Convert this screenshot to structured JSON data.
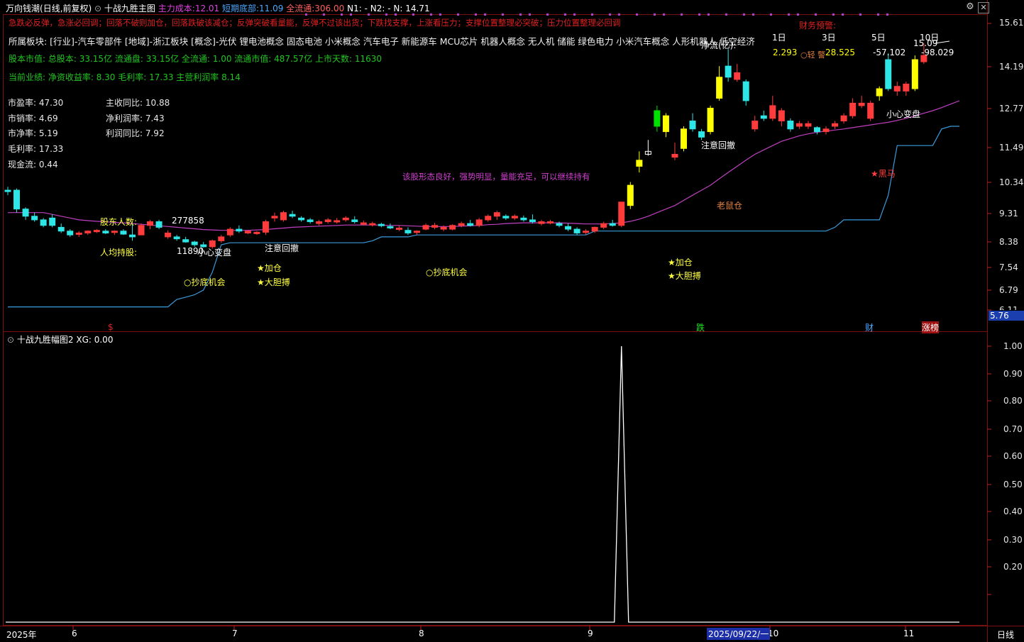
{
  "header": {
    "stock_name": "万向钱潮",
    "period": "(日线,前复权)",
    "indicator": "十战九胜主图",
    "cost_label": "主力成本:",
    "cost_value": "12.01",
    "short_bottom_label": "短期底部:",
    "short_bottom_value": "11.09",
    "float_label": "全流通:",
    "float_value": "306.00",
    "n1_label": "N1: -",
    "n2_label": "N2: -",
    "n_label": "N: 14.71"
  },
  "warning_line": "急跌必反弹，急涨必回调；回落不破则加仓，回落跌破该减仓；反弹突破看量能，反弹不过该出货；下跌找支撑，上涨看压力；支撑位置整理必突破；压力位置整理必回调",
  "sectors_line": "所属板块: [行业]-汽车零部件 [地域]-浙江板块 [概念]-光伏 锂电池概念 固态电池 小米概念 汽车电子 新能源车 MCU芯片 机器人概念 无人机 储能 绿色电力 小米汽车概念 人形机器人 低空经济",
  "market_value_line": "股本市值: 总股本: 33.15亿 流通盘: 33.15亿 全流通: 1.00 流通市值: 487.57亿 上市天数: 11630",
  "performance_line": "当前业绩:  净资收益率: 8.30 毛利率: 17.33 主营利润率 8.14",
  "finance_left": [
    {
      "label": "市盈率: 47.30"
    },
    {
      "label": "市销率: 4.69"
    },
    {
      "label": "市净率: 5.19"
    },
    {
      "label": "毛利率: 17.33"
    },
    {
      "label": "现金流: 0.44"
    }
  ],
  "finance_right": [
    {
      "label": "主收同比: 10.88"
    },
    {
      "label": "净利润率: 7.43"
    },
    {
      "label": "利润同比: 7.92"
    }
  ],
  "fund_flow": {
    "title": "财务预警:",
    "flow_label": "净流(亿):",
    "periods": [
      "1日",
      "3日",
      "5日",
      "10日"
    ],
    "values": [
      "2.293",
      "28.525",
      "-57.102",
      "-98.029"
    ],
    "alert": "○轻 警"
  },
  "shareholders": {
    "label": "股东人数:",
    "value": "277858",
    "avg_label": "人均持股:",
    "avg_value": "11890"
  },
  "comment": "该股形态良好，强势明显，量能充足，可以继续持有",
  "annotations": {
    "careful": "小心变盘",
    "careful_right": "小心变盘",
    "pullback_1": "注意回撤",
    "pullback_2": "注意回撤",
    "add_1": "★加仓",
    "add_2": "★加仓",
    "bold_1": "★大胆搏",
    "bold_2": "★大胆搏",
    "bottom_1": "○抄底机会",
    "bottom_2": "○抄底机会",
    "rat": "老鼠仓",
    "dark_horse": "★黑马",
    "high_price": "15.09"
  },
  "bottom_markers": {
    "dollar": "$",
    "fall": "跌",
    "finance": "财",
    "limit_list": "涨榜"
  },
  "price_axis": [
    "15.61",
    "14.19",
    "12.77",
    "11.49",
    "10.34",
    "9.31",
    "8.38",
    "7.54",
    "6.79",
    "6.11"
  ],
  "price_axis_current": "5.76",
  "sub_panel": {
    "title": "十战九胜幅图2",
    "xg_label": "XG: 0.00",
    "axis": [
      "1.00",
      "0.90",
      "0.80",
      "0.70",
      "0.60",
      "0.50",
      "0.40",
      "0.30",
      "0.20"
    ]
  },
  "time_axis": {
    "labels": [
      "2025年",
      "6",
      "7",
      "8",
      "9",
      "10",
      "11"
    ],
    "cursor_date": "2025/09/22/一",
    "period_label": "日线"
  },
  "colors": {
    "up": "#ff3b3b",
    "down": "#2ee6e6",
    "ma": "#c040c0",
    "support": "#3a9bdc",
    "yellow": "#ffff00",
    "green": "#00e000",
    "accent_red": "#e02020"
  },
  "chart_data": {
    "type": "candlestick",
    "y_scale": "log",
    "ylim": [
      5.76,
      15.61
    ],
    "count": 108,
    "candles": [
      [
        8.85,
        8.95,
        8.7,
        8.85,
        "d"
      ],
      [
        8.85,
        8.9,
        8.2,
        8.3,
        "d"
      ],
      [
        8.3,
        8.35,
        8.0,
        8.1,
        "d"
      ],
      [
        8.1,
        8.2,
        7.95,
        8.0,
        "d"
      ],
      [
        8.0,
        8.05,
        7.8,
        7.85,
        "d"
      ],
      [
        7.85,
        8.15,
        7.8,
        8.05,
        "d"
      ],
      [
        7.8,
        7.9,
        7.65,
        7.7,
        "d"
      ],
      [
        7.7,
        7.75,
        7.55,
        7.6,
        "d"
      ],
      [
        7.62,
        7.7,
        7.55,
        7.65,
        "u"
      ],
      [
        7.65,
        7.72,
        7.6,
        7.7,
        "u"
      ],
      [
        7.7,
        7.75,
        7.65,
        7.72,
        "u"
      ],
      [
        7.7,
        7.75,
        7.62,
        7.65,
        "d"
      ],
      [
        7.68,
        7.72,
        7.6,
        7.7,
        "u"
      ],
      [
        7.7,
        7.75,
        7.6,
        7.62,
        "d"
      ],
      [
        7.6,
        7.9,
        7.45,
        7.55,
        "d"
      ],
      [
        7.6,
        7.9,
        7.6,
        7.85,
        "u"
      ],
      [
        7.85,
        8.0,
        7.75,
        7.95,
        "u"
      ],
      [
        7.95,
        8.0,
        7.75,
        7.8,
        "d"
      ],
      [
        7.65,
        7.72,
        7.5,
        7.55,
        "u"
      ],
      [
        7.55,
        7.6,
        7.45,
        7.5,
        "d"
      ],
      [
        7.48,
        7.55,
        7.4,
        7.42,
        "d"
      ],
      [
        7.42,
        7.45,
        7.3,
        7.35,
        "d"
      ],
      [
        7.35,
        7.42,
        7.28,
        7.3,
        "d"
      ],
      [
        7.3,
        7.48,
        7.25,
        7.45,
        "u"
      ],
      [
        7.45,
        7.6,
        7.4,
        7.55,
        "u"
      ],
      [
        7.6,
        7.8,
        7.55,
        7.75,
        "u"
      ],
      [
        7.75,
        7.85,
        7.65,
        7.7,
        "d"
      ],
      [
        7.7,
        7.72,
        7.62,
        7.65,
        "u"
      ],
      [
        7.65,
        7.7,
        7.6,
        7.67,
        "u"
      ],
      [
        7.67,
        8.0,
        7.6,
        7.95,
        "u"
      ],
      [
        8.05,
        8.2,
        7.95,
        8.1,
        "u"
      ],
      [
        8.0,
        8.25,
        7.95,
        8.2,
        "u"
      ],
      [
        8.15,
        8.25,
        8.05,
        8.1,
        "d"
      ],
      [
        8.05,
        8.1,
        7.95,
        8.0,
        "d"
      ],
      [
        8.0,
        8.05,
        7.9,
        7.95,
        "d"
      ],
      [
        7.9,
        8.0,
        7.85,
        7.95,
        "u"
      ],
      [
        7.95,
        8.05,
        7.9,
        8.0,
        "u"
      ],
      [
        7.95,
        8.05,
        7.9,
        7.98,
        "u"
      ],
      [
        8.0,
        8.1,
        7.95,
        8.05,
        "u"
      ],
      [
        8.0,
        8.1,
        7.9,
        7.95,
        "d"
      ],
      [
        7.92,
        7.98,
        7.85,
        7.88,
        "u"
      ],
      [
        7.88,
        7.95,
        7.82,
        7.9,
        "u"
      ],
      [
        7.88,
        7.92,
        7.8,
        7.85,
        "d"
      ],
      [
        7.82,
        7.9,
        7.75,
        7.8,
        "d"
      ],
      [
        7.78,
        7.85,
        7.7,
        7.75,
        "u"
      ],
      [
        7.72,
        7.8,
        7.6,
        7.65,
        "d"
      ],
      [
        7.68,
        7.72,
        7.6,
        7.7,
        "u"
      ],
      [
        7.75,
        7.9,
        7.72,
        7.85,
        "u"
      ],
      [
        7.85,
        7.92,
        7.75,
        7.8,
        "u"
      ],
      [
        7.8,
        7.85,
        7.7,
        7.75,
        "u"
      ],
      [
        7.75,
        7.88,
        7.72,
        7.85,
        "u"
      ],
      [
        7.85,
        7.95,
        7.8,
        7.9,
        "u"
      ],
      [
        7.9,
        8.0,
        7.82,
        7.85,
        "d"
      ],
      [
        7.85,
        8.05,
        7.8,
        8.0,
        "u"
      ],
      [
        8.0,
        8.15,
        7.95,
        8.1,
        "u"
      ],
      [
        8.1,
        8.25,
        8.0,
        8.2,
        "u"
      ],
      [
        8.1,
        8.15,
        8.0,
        8.05,
        "d"
      ],
      [
        8.05,
        8.15,
        8.0,
        8.1,
        "u"
      ],
      [
        8.05,
        8.12,
        7.95,
        8.0,
        "d"
      ],
      [
        8.0,
        8.15,
        7.9,
        7.95,
        "d"
      ],
      [
        7.95,
        8.0,
        7.85,
        7.9,
        "u"
      ],
      [
        7.92,
        8.0,
        7.88,
        7.95,
        "u"
      ],
      [
        7.9,
        7.95,
        7.8,
        7.85,
        "d"
      ],
      [
        7.82,
        7.9,
        7.7,
        7.75,
        "d"
      ],
      [
        7.75,
        7.8,
        7.6,
        7.65,
        "d"
      ],
      [
        7.68,
        7.75,
        7.6,
        7.7,
        "u"
      ],
      [
        7.7,
        7.82,
        7.65,
        7.8,
        "u"
      ],
      [
        7.8,
        7.95,
        7.75,
        7.9,
        "u"
      ],
      [
        7.9,
        8.0,
        7.82,
        7.85,
        "d"
      ],
      [
        7.85,
        8.3,
        7.8,
        8.5,
        "u"
      ],
      [
        8.4,
        9.1,
        8.3,
        9.0,
        "y"
      ],
      [
        9.6,
        10.1,
        9.4,
        9.8,
        "y"
      ],
      [
        10.0,
        10.5,
        9.95,
        10.1,
        "w"
      ],
      [
        11.0,
        11.8,
        10.8,
        11.6,
        "g"
      ],
      [
        11.4,
        11.5,
        10.6,
        10.8,
        "y"
      ],
      [
        10.0,
        10.4,
        9.8,
        9.9,
        "u"
      ],
      [
        10.2,
        11.0,
        10.1,
        10.9,
        "y"
      ],
      [
        10.9,
        11.5,
        10.8,
        11.2,
        "d"
      ],
      [
        10.6,
        10.9,
        10.5,
        10.8,
        "d"
      ],
      [
        10.8,
        11.8,
        10.7,
        11.7,
        "y"
      ],
      [
        12.1,
        13.5,
        12.0,
        13.0,
        "y"
      ],
      [
        13.0,
        14.3,
        12.8,
        13.5,
        "d"
      ],
      [
        13.2,
        13.6,
        12.8,
        12.9,
        "u"
      ],
      [
        12.8,
        12.9,
        11.8,
        12.0,
        "d"
      ],
      [
        11.2,
        11.4,
        10.8,
        10.9,
        "u"
      ],
      [
        11.4,
        11.6,
        11.2,
        11.3,
        "d"
      ],
      [
        11.3,
        12.2,
        11.2,
        11.8,
        "u"
      ],
      [
        11.6,
        11.7,
        11.0,
        11.2,
        "u"
      ],
      [
        11.2,
        11.3,
        10.8,
        10.9,
        "d"
      ],
      [
        11.0,
        11.2,
        10.9,
        11.1,
        "u"
      ],
      [
        11.1,
        11.2,
        10.9,
        11.0,
        "u"
      ],
      [
        10.95,
        11.0,
        10.7,
        10.8,
        "d"
      ],
      [
        10.8,
        11.0,
        10.7,
        10.9,
        "u"
      ],
      [
        11.0,
        11.2,
        10.9,
        11.1,
        "u"
      ],
      [
        11.2,
        11.5,
        11.1,
        11.4,
        "u"
      ],
      [
        11.4,
        12.1,
        11.3,
        11.9,
        "u"
      ],
      [
        11.9,
        12.2,
        11.7,
        11.8,
        "u"
      ],
      [
        11.3,
        12.0,
        11.2,
        11.9,
        "u"
      ],
      [
        12.2,
        12.6,
        12.0,
        12.5,
        "y"
      ],
      [
        12.5,
        14.1,
        12.4,
        13.8,
        "d"
      ],
      [
        12.6,
        12.8,
        12.2,
        12.4,
        "u"
      ],
      [
        12.4,
        12.8,
        12.2,
        12.7,
        "u"
      ],
      [
        12.5,
        14.0,
        12.4,
        13.8,
        "y"
      ],
      [
        13.7,
        14.6,
        13.6,
        14.0,
        "u"
      ]
    ],
    "ma_line": [
      8.2,
      8.2,
      8.2,
      8.2,
      8.2,
      8.15,
      8.1,
      8.05,
      8.0,
      7.98,
      7.96,
      7.95,
      7.93,
      7.92,
      7.9,
      7.88,
      7.86,
      7.84,
      7.82,
      7.8,
      7.78,
      7.76,
      7.74,
      7.73,
      7.72,
      7.72,
      7.72,
      7.72,
      7.73,
      7.74,
      7.76,
      7.78,
      7.8,
      7.81,
      7.82,
      7.83,
      7.84,
      7.85,
      7.86,
      7.86,
      7.86,
      7.86,
      7.86,
      7.85,
      7.85,
      7.84,
      7.83,
      7.82,
      7.82,
      7.82,
      7.82,
      7.83,
      7.84,
      7.85,
      7.87,
      7.88,
      7.9,
      7.91,
      7.92,
      7.92,
      7.92,
      7.92,
      7.92,
      7.91,
      7.9,
      7.89,
      7.89,
      7.89,
      7.9,
      7.92,
      7.96,
      8.02,
      8.1,
      8.2,
      8.3,
      8.4,
      8.55,
      8.7,
      8.85,
      9.0,
      9.2,
      9.4,
      9.6,
      9.8,
      10.0,
      10.15,
      10.3,
      10.45,
      10.55,
      10.65,
      10.72,
      10.78,
      10.82,
      10.86,
      10.9,
      10.95,
      11.0,
      11.05,
      11.1,
      11.15,
      11.22,
      11.3,
      11.4,
      11.5,
      11.6,
      11.72,
      11.86,
      12.0
    ],
    "support_line": [
      5.95,
      5.95,
      5.95,
      5.95,
      5.95,
      5.95,
      5.95,
      5.95,
      5.95,
      5.95,
      5.95,
      5.95,
      5.95,
      5.95,
      5.95,
      5.95,
      5.95,
      5.95,
      5.95,
      6.1,
      6.15,
      6.2,
      6.3,
      6.7,
      7.35,
      7.4,
      7.4,
      7.4,
      7.4,
      7.4,
      7.4,
      7.4,
      7.4,
      7.4,
      7.4,
      7.4,
      7.4,
      7.4,
      7.4,
      7.4,
      7.4,
      7.45,
      7.55,
      7.55,
      7.55,
      7.55,
      7.6,
      7.6,
      7.6,
      7.6,
      7.6,
      7.6,
      7.6,
      7.6,
      7.6,
      7.6,
      7.6,
      7.6,
      7.6,
      7.6,
      7.6,
      7.6,
      7.6,
      7.6,
      7.6,
      7.6,
      7.7,
      7.7,
      7.7,
      7.7,
      7.7,
      7.7,
      7.7,
      7.7,
      7.7,
      7.7,
      7.7,
      7.7,
      7.7,
      7.7,
      7.7,
      7.7,
      7.7,
      7.7,
      7.7,
      7.7,
      7.7,
      7.7,
      7.7,
      7.7,
      7.7,
      7.7,
      7.7,
      7.8,
      8.0,
      8.0,
      8.0,
      8.0,
      8.0,
      8.7,
      10.3,
      10.3,
      10.3,
      10.3,
      10.3,
      10.9,
      11.0,
      11.0
    ],
    "sub_xg": {
      "spike_index": 69,
      "spike_value": 1.0,
      "baseline": 0.0,
      "ylim": [
        0,
        1.0
      ]
    }
  }
}
